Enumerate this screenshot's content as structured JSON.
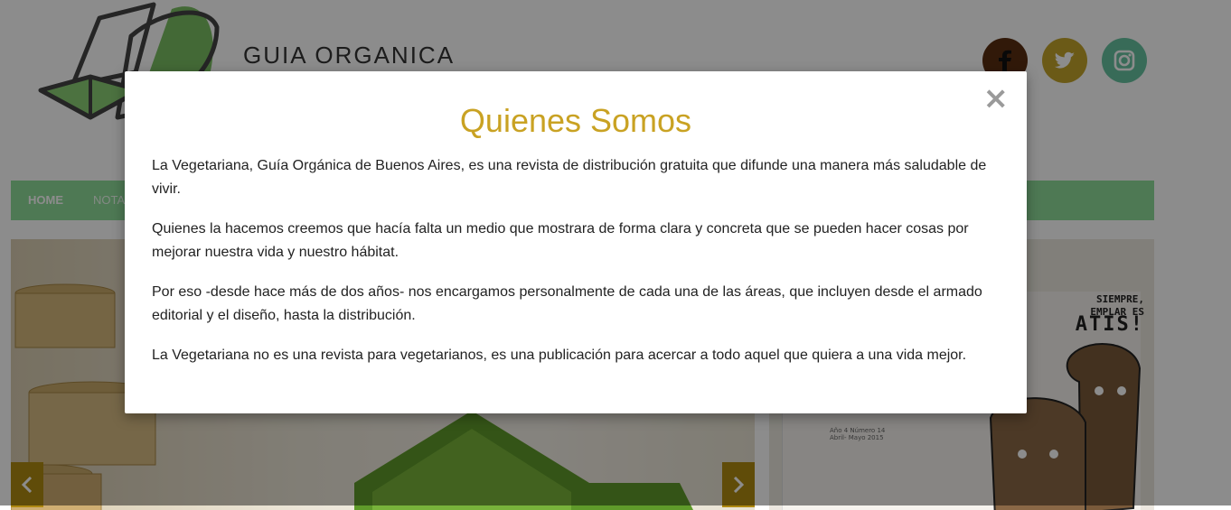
{
  "site": {
    "brand": "GUIA ORGANICA",
    "logo_icon": "leaf-logo-icon",
    "social": [
      {
        "name": "facebook-icon",
        "color": "#5a2e12"
      },
      {
        "name": "twitter-icon",
        "color": "#c4a52a"
      },
      {
        "name": "instagram-icon",
        "color": "#67c4a0"
      }
    ]
  },
  "nav": {
    "items": [
      {
        "label": "HOME"
      },
      {
        "label": "NOTA"
      }
    ],
    "color": "#8fdc9a"
  },
  "slider": {
    "prev_icon": "chevron-left-icon",
    "next_icon": "chevron-right-icon",
    "arrow_color": "#b08a12"
  },
  "magazine": {
    "line1": "SIEMPRE,",
    "line2": "EMPLAR ES",
    "line3": "ATIS!",
    "issue_line1": "Año 4 Número 14",
    "issue_line2": "Abril- Mayo 2015"
  },
  "modal": {
    "title": "Quienes Somos",
    "title_color": "#c9a223",
    "close_label": "×",
    "paragraphs": [
      "La Vegetariana, Guía Orgánica de Buenos Aires, es una revista de distribución gratuita que difunde una manera más saludable de vivir.",
      "Quienes la hacemos creemos que hacía falta un medio que mostrara de forma clara y concreta que se pueden hacer cosas por mejorar nuestra vida y nuestro hábitat.",
      "Por eso -desde hace más de dos años- nos encargamos personalmente de cada una de las áreas, que incluyen desde el armado editorial y el diseño, hasta la distribución.",
      "La Vegetariana no es una revista para vegetarianos, es una publicación para acercar a todo aquel que quiera a una vida mejor."
    ]
  }
}
